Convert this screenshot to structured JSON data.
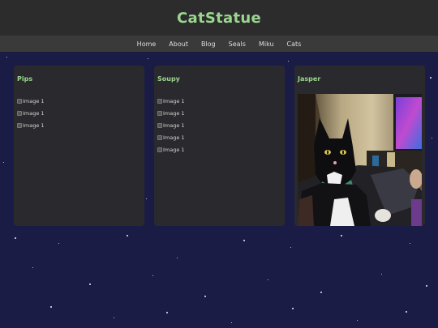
{
  "site": {
    "title": "CatStatue"
  },
  "nav": {
    "items": [
      "Home",
      "About",
      "Blog",
      "Seals",
      "Miku",
      "Cats"
    ]
  },
  "cards": [
    {
      "title": "Pips",
      "images": [
        "Image 1",
        "Image 1",
        "Image 1"
      ]
    },
    {
      "title": "Soupy",
      "images": [
        "Image 1",
        "Image 1",
        "Image 1",
        "Image 1",
        "Image 1"
      ]
    },
    {
      "title": "Jasper",
      "photo": "black-and-white-cat-photo"
    }
  ],
  "colors": {
    "accent": "#9bd68f",
    "background": "#1b1c45",
    "card": "#2a2a2e",
    "header": "#2c2c2c",
    "nav": "#3a3a3a"
  }
}
